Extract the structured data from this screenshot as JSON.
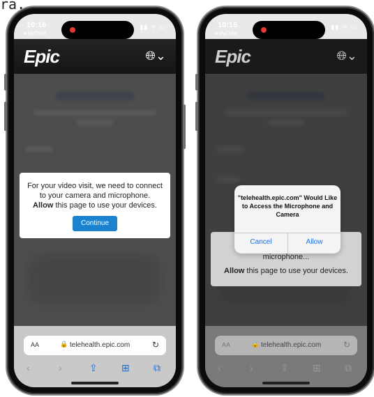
{
  "caption": "ra.",
  "phones": [
    {
      "id": "left",
      "status": {
        "time": "10:16",
        "back_app": "◂ MyChart",
        "icons": "▮▮ ᯤ ▭"
      },
      "header": {
        "brand": "Epic",
        "globe_icon": "🌐︎⌄"
      },
      "dialog": {
        "line1": "For your video visit, we need to connect to your camera and microphone.",
        "allow_bold": "Allow",
        "line2": " this page to use your devices.",
        "button": "Continue"
      },
      "safari": {
        "aa": "AA",
        "lock": "🔒",
        "domain": "telehealth.epic.com",
        "reload": "↻",
        "toolbar": [
          "‹",
          "›",
          "⇪",
          "⊞",
          "⧉"
        ]
      }
    },
    {
      "id": "right",
      "status": {
        "time": "10:16",
        "back_app": "◂ MyChart",
        "icons": "▮▮ ᯤ ▭"
      },
      "header": {
        "brand": "Epic",
        "globe_icon": "🌐︎⌄"
      },
      "alert": {
        "text": "\"telehealth.epic.com\" Would Like to Access the Microphone and Camera",
        "cancel": "Cancel",
        "allow": "Allow"
      },
      "dialog": {
        "mic": "microphone...",
        "allow_bold": "Allow",
        "line2": " this page to use your devices."
      },
      "safari": {
        "aa": "AA",
        "lock": "🔒",
        "domain": "telehealth.epic.com",
        "reload": "↻",
        "toolbar": [
          "‹",
          "›",
          "⇪",
          "⊞",
          "⧉"
        ]
      }
    }
  ],
  "colors": {
    "continue": "#1a82cf",
    "alert_link": "#1c6ee8",
    "header": "#1b1b1b"
  }
}
